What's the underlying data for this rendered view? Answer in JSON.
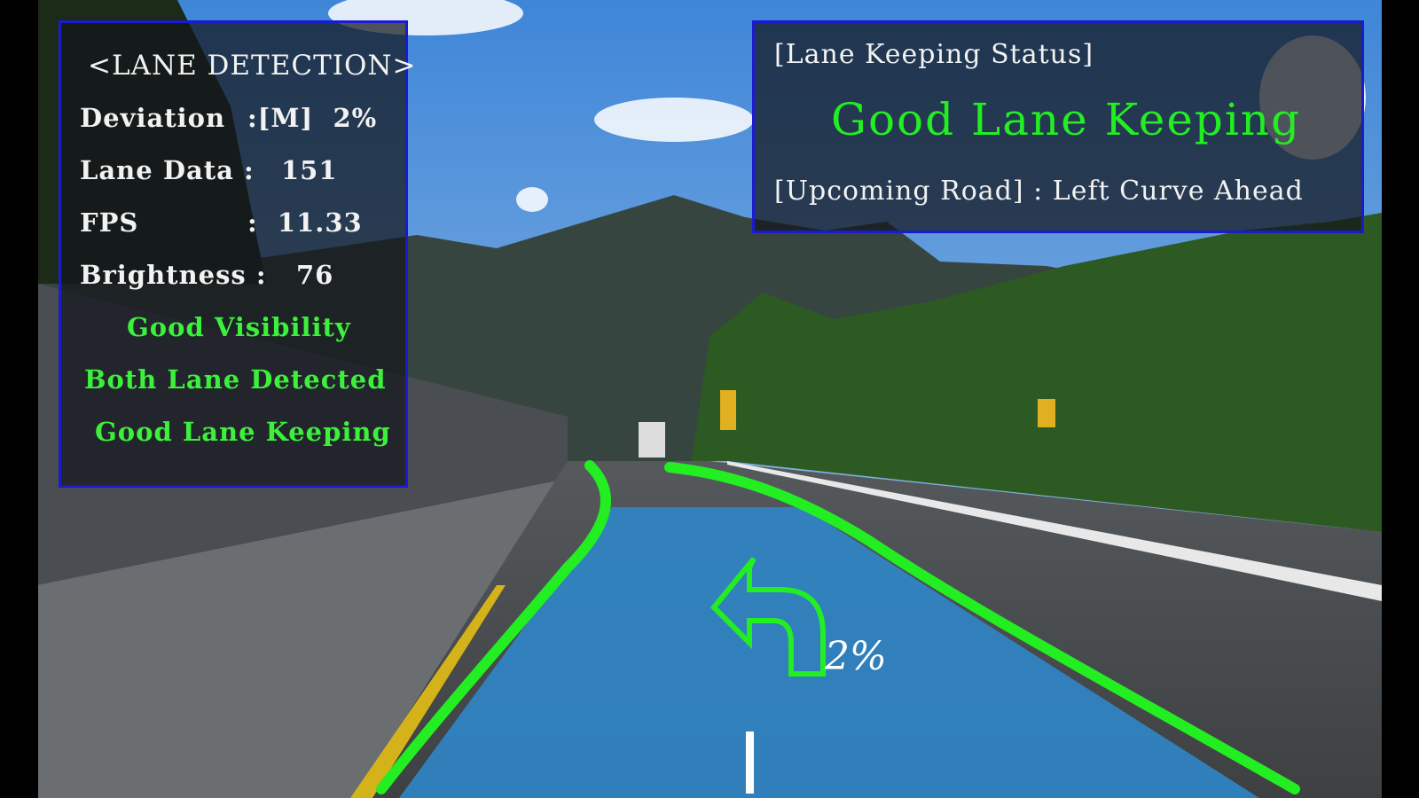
{
  "lane_detection_panel": {
    "title": "<LANE DETECTION>",
    "deviation_label": "Deviation",
    "deviation_value": ":[M]  2%",
    "lane_data_label": "Lane Data :",
    "lane_data_value": "151",
    "fps_label": "FPS",
    "fps_value": ":  11.33",
    "brightness_label": "Brightness :",
    "brightness_value": "76",
    "visibility_status": "Good Visibility",
    "lane_status": "Both Lane Detected",
    "keeping_status": "Good Lane Keeping"
  },
  "lane_keeping_panel": {
    "title": "[Lane Keeping Status]",
    "status": "Good Lane Keeping",
    "upcoming_road": "[Upcoming Road] : Left Curve Ahead"
  },
  "overlay": {
    "turn_arrow_icon": "left-curve-arrow",
    "deviation_percent": "2%"
  },
  "colors": {
    "lane_line": "#22ee22",
    "lane_fill": "#2f86c8",
    "panel_border": "#1a1ad0",
    "status_text": "#3cf03c"
  }
}
